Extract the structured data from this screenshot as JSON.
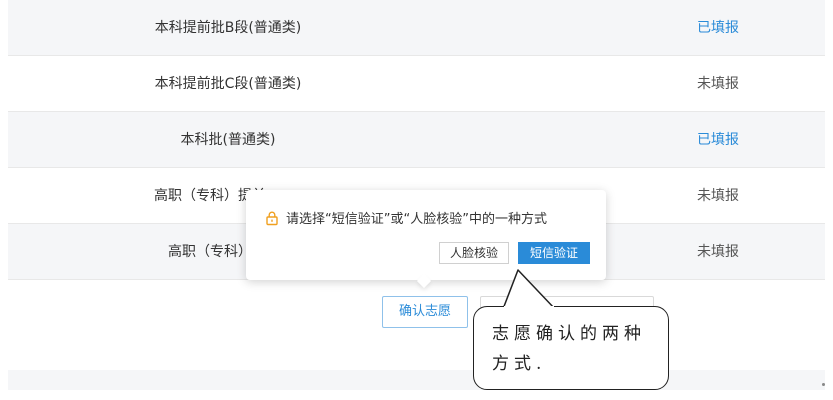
{
  "rows": [
    {
      "name": "本科提前批B段(普通类)",
      "status": "已填报",
      "filled": true
    },
    {
      "name": "本科提前批C段(普通类)",
      "status": "未填报",
      "filled": false
    },
    {
      "name": "本科批(普通类)",
      "status": "已填报",
      "filled": true
    },
    {
      "name": "高职（专科）提前",
      "status": "未填报",
      "filled": false
    },
    {
      "name": "高职（专科）批",
      "status": "未填报",
      "filled": false
    }
  ],
  "confirm_button": "确认志愿",
  "popover": {
    "icon": "lock-icon",
    "message": "请选择“短信验证”或“人脸核验”中的一种方式",
    "face_button": "人脸核验",
    "sms_button": "短信验证"
  },
  "callout": {
    "line1": "志愿确认的两种",
    "line2": "方式."
  },
  "colors": {
    "accent": "#2a8bd8",
    "row_shade": "#f5f6f8",
    "lock": "#f0a020"
  }
}
